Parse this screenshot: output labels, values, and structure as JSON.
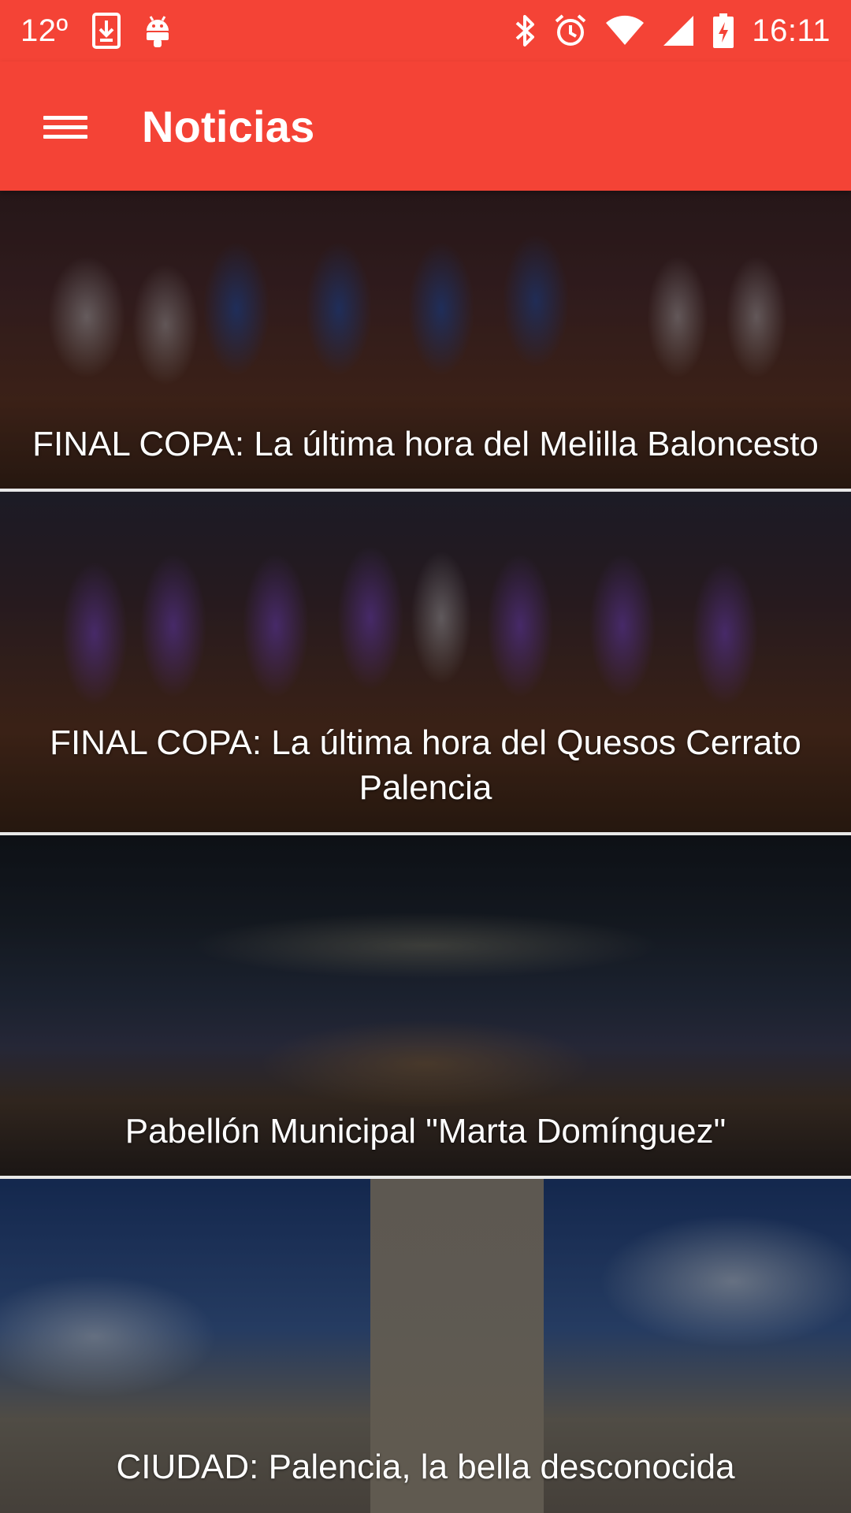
{
  "status_bar": {
    "temperature": "12º",
    "time": "16:11",
    "icons": [
      "download-icon",
      "android-icon",
      "bluetooth-icon",
      "alarm-icon",
      "wifi-icon",
      "signal-icon",
      "battery-charging-icon"
    ],
    "background_color": "#f44336"
  },
  "app_bar": {
    "title": "Noticias",
    "menu_icon": "hamburger-menu-icon",
    "background_color": "#f44336"
  },
  "news": [
    {
      "title": "FINAL COPA: La última hora del Melilla Baloncesto"
    },
    {
      "title": "FINAL COPA: La última hora del Quesos Cerrato Palencia"
    },
    {
      "title": "Pabellón Municipal \"Marta Domínguez\""
    },
    {
      "title": "CIUDAD: Palencia, la bella desconocida"
    }
  ]
}
